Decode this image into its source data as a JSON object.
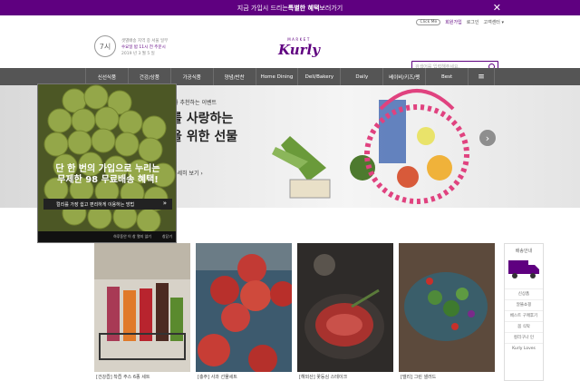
{
  "banner": {
    "text_prefix": "지금 가입시 드리는 ",
    "text_bold": "특별한 혜택",
    "text_suffix": " 보러가기"
  },
  "util": {
    "clickme": "Click Me",
    "join": "회원가입",
    "login": "로그인",
    "support": "고객센터 ▾"
  },
  "delivery": {
    "badge": "7시",
    "line1": "샛별배송 지역 중 서울 일부",
    "line2": "수요일 밤 11시 전 주문시",
    "line3": "2019 년 3 월 5 일"
  },
  "logo": {
    "small": "MARKET",
    "big": "Kurly"
  },
  "search": {
    "placeholder": "검색어를 입력해주세요."
  },
  "nav": {
    "items": [
      "신선식품",
      "건강/상품",
      "가공식품",
      "양념/반찬",
      "Home Dining",
      "Deli/Bakery",
      "Daily",
      "베이비/키즈/펫",
      "Best"
    ],
    "menu_icon": "≡"
  },
  "hero": {
    "tag": "컬리가 추천하는 이벤트",
    "headline1": "를 사랑하는",
    "headline2": "을 위한 선물",
    "more": "자세히 보기 ›"
  },
  "popup": {
    "title_line1": "단 한 번의 가입으로 누리는",
    "title_line2": "무제한 98 무료배송 혜택!",
    "cta": "컬리를 가장 쉽고 편리하게 이용하는 방법",
    "cta_arrow": "»",
    "foot_left": "하루동안 이 창 열지 않기",
    "foot_right": "창닫기"
  },
  "cards": [
    {
      "caption": "[건강즙] 착즙 주스 6종 세트"
    },
    {
      "caption": "[충주] 사과 선물세트"
    },
    {
      "caption": "[해외산] 꽃등심 스테이크"
    },
    {
      "caption": "[델리] 그린 샐러드"
    }
  ],
  "sidebar": {
    "head": "배송안내",
    "links": [
      "신상품",
      "알뜰쇼핑",
      "베스트 구매후기",
      "봄 식탁",
      "컬리구나 인",
      "Kurly Loves"
    ]
  },
  "colors": {
    "brand": "#5f0080",
    "nav_bg": "#555555"
  }
}
